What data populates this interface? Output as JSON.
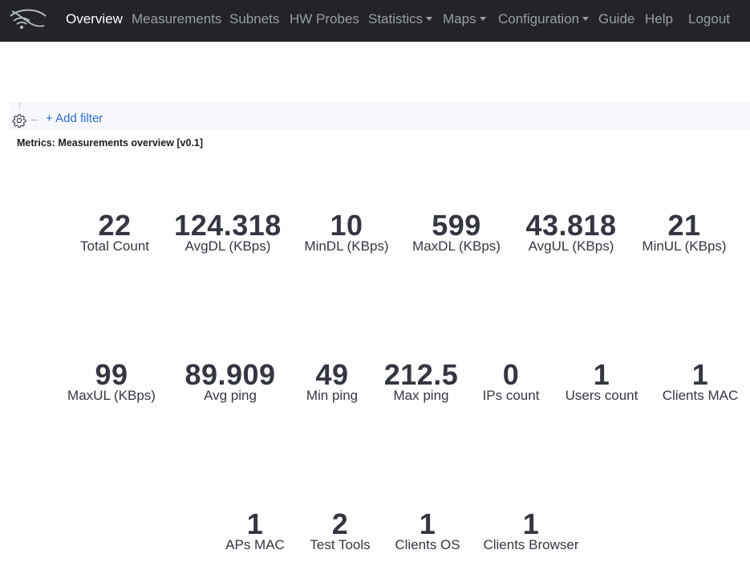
{
  "nav": {
    "items": [
      {
        "label": "Overview",
        "active": true,
        "dropdown": false
      },
      {
        "label": "Measurements",
        "active": false,
        "dropdown": false
      },
      {
        "label": "Subnets",
        "active": false,
        "dropdown": false
      },
      {
        "label": "HW Probes",
        "active": false,
        "dropdown": false
      },
      {
        "label": "Statistics",
        "active": false,
        "dropdown": true
      },
      {
        "label": "Maps",
        "active": false,
        "dropdown": true
      },
      {
        "label": "Configuration",
        "active": false,
        "dropdown": true
      },
      {
        "label": "Guide",
        "active": false,
        "dropdown": false
      },
      {
        "label": "Help",
        "active": false,
        "dropdown": false
      },
      {
        "label": "Logout",
        "active": false,
        "dropdown": false
      }
    ]
  },
  "filter": {
    "add_label": "+ Add filter"
  },
  "panel": {
    "title": "Metrics: Measurements overview [v0.1]"
  },
  "metrics": [
    {
      "value": "22",
      "label": "Total Count"
    },
    {
      "value": "124.318",
      "label": "AvgDL (KBps)"
    },
    {
      "value": "10",
      "label": "MinDL (KBps)"
    },
    {
      "value": "599",
      "label": "MaxDL (KBps)"
    },
    {
      "value": "43.818",
      "label": "AvgUL (KBps)"
    },
    {
      "value": "21",
      "label": "MinUL (KBps)"
    },
    {
      "value": "99",
      "label": "MaxUL (KBps)"
    },
    {
      "value": "89.909",
      "label": "Avg ping"
    },
    {
      "value": "49",
      "label": "Min ping"
    },
    {
      "value": "212.5",
      "label": "Max ping"
    },
    {
      "value": "0",
      "label": "IPs count"
    },
    {
      "value": "1",
      "label": "Users count"
    },
    {
      "value": "1",
      "label": "Clients MAC"
    },
    {
      "value": "1",
      "label": "APs MAC"
    },
    {
      "value": "2",
      "label": "Test Tools"
    },
    {
      "value": "1",
      "label": "Clients OS"
    },
    {
      "value": "1",
      "label": "Clients Browser"
    }
  ],
  "colors": {
    "navbar_bg": "#222428",
    "nav_active": "#ffffff",
    "nav_inactive": "#9a9da2",
    "link": "#2f6bcb",
    "metric_text": "#343741"
  }
}
